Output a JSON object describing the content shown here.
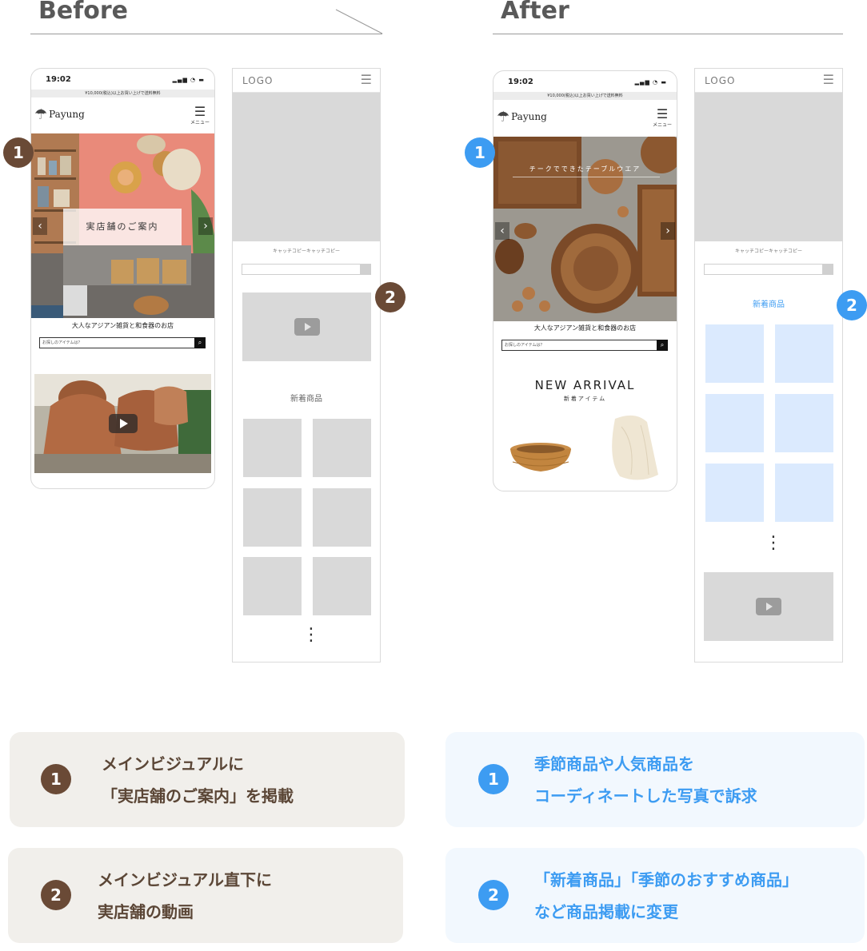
{
  "before": {
    "title": "Before",
    "phone": {
      "time": "19:02",
      "signal": "▂▄▆ ◔ ▬",
      "notice": "¥10,000(税込)以上お買い上げで送料無料",
      "brand": "Payung",
      "menu_label": "メニュー",
      "hero_text": "実店舗のご案内",
      "tagline": "大人なアジアン雑貨と和食器のお店",
      "search_placeholder": "お探しのアイテムは？"
    },
    "wire": {
      "logo": "LOGO",
      "catch": "キャッチコピーキャッチコピー",
      "section": "新着商品",
      "more": "⋮"
    }
  },
  "after": {
    "title": "After",
    "phone": {
      "time": "19:02",
      "signal": "▂▄▆ ◔ ▬",
      "notice": "¥10,000(税込)以上お買い上げで送料無料",
      "brand": "Payung",
      "menu_label": "メニュー",
      "hero_text": "チークでできたテーブルウエア",
      "tagline": "大人なアジアン雑貨と和食器のお店",
      "search_placeholder": "お探しのアイテムは？",
      "arrival_title": "NEW ARRIVAL",
      "arrival_sub": "新着アイテム"
    },
    "wire": {
      "logo": "LOGO",
      "catch": "キャッチコピーキャッチコピー",
      "section": "新着商品",
      "more": "⋮"
    }
  },
  "badges": {
    "one": "1",
    "two": "2"
  },
  "notes": {
    "before_1": [
      "メインビジュアルに",
      "「実店舗のご案内」を掲載"
    ],
    "before_2": [
      "メインビジュアル直下に",
      "実店舗の動画"
    ],
    "after_1": [
      "季節商品や人気商品を",
      "コーディネートした写真で訴求"
    ],
    "after_2": [
      "「新着商品」「季節のおすすめ商品」",
      "など商品掲載に変更"
    ]
  },
  "colors": {
    "brown": "#6a4a36",
    "blue": "#3d9cf2",
    "beige_card": "#f1efeb",
    "blue_card": "#f2f8fe",
    "placeholder_gray": "#d9d9d9",
    "placeholder_blue": "#dbeafe"
  },
  "icons": {
    "menu": "hamburger-icon",
    "search": "search-icon",
    "play": "play-icon",
    "prev": "chevron-left-icon",
    "next": "chevron-right-icon",
    "umbrella": "umbrella-logo-icon"
  }
}
